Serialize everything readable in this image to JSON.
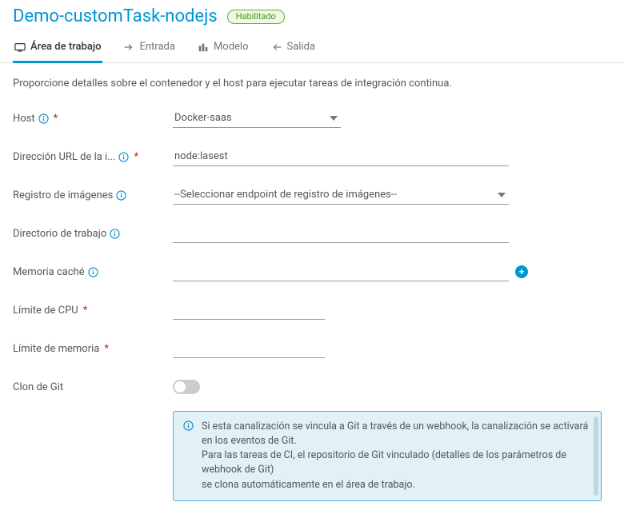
{
  "header": {
    "title": "Demo-customTask-nodejs",
    "status_badge": "Habilitado"
  },
  "tabs": [
    {
      "label": "Área de trabajo",
      "icon": "workspace-icon",
      "active": true
    },
    {
      "label": "Entrada",
      "icon": "input-icon",
      "active": false
    },
    {
      "label": "Modelo",
      "icon": "model-icon",
      "active": false
    },
    {
      "label": "Salida",
      "icon": "output-icon",
      "active": false
    }
  ],
  "description": "Proporcione detalles sobre el contenedor y el host para ejecutar tareas de integración continua.",
  "form": {
    "host": {
      "label": "Host",
      "value": "Docker-saas",
      "required": true,
      "info": true
    },
    "image_url": {
      "label": "Dirección URL de la i...",
      "value": "node:lasest",
      "required": true,
      "info": true
    },
    "registry": {
      "label": "Registro de imágenes",
      "value": "--Seleccionar endpoint de registro de imágenes--",
      "required": false,
      "info": true
    },
    "workdir": {
      "label": "Directorio de trabajo",
      "value": "",
      "required": false,
      "info": true
    },
    "cache": {
      "label": "Memoria caché",
      "value": "",
      "required": false,
      "info": true
    },
    "cpu_limit": {
      "label": "Límite de CPU",
      "value": "",
      "required": true,
      "info": false
    },
    "mem_limit": {
      "label": "Límite de memoria",
      "value": "",
      "required": true,
      "info": false
    },
    "git_clone": {
      "label": "Clon de Git",
      "enabled": false
    }
  },
  "info_panel": {
    "line1": "Si esta canalización se vincula a Git a través de un webhook, la canalización se activará en los eventos de Git.",
    "line2": "Para las tareas de CI, el repositorio de Git vinculado (detalles de los parámetros de webhook de Git)",
    "line3": "se clona automáticamente en el área de trabajo."
  }
}
